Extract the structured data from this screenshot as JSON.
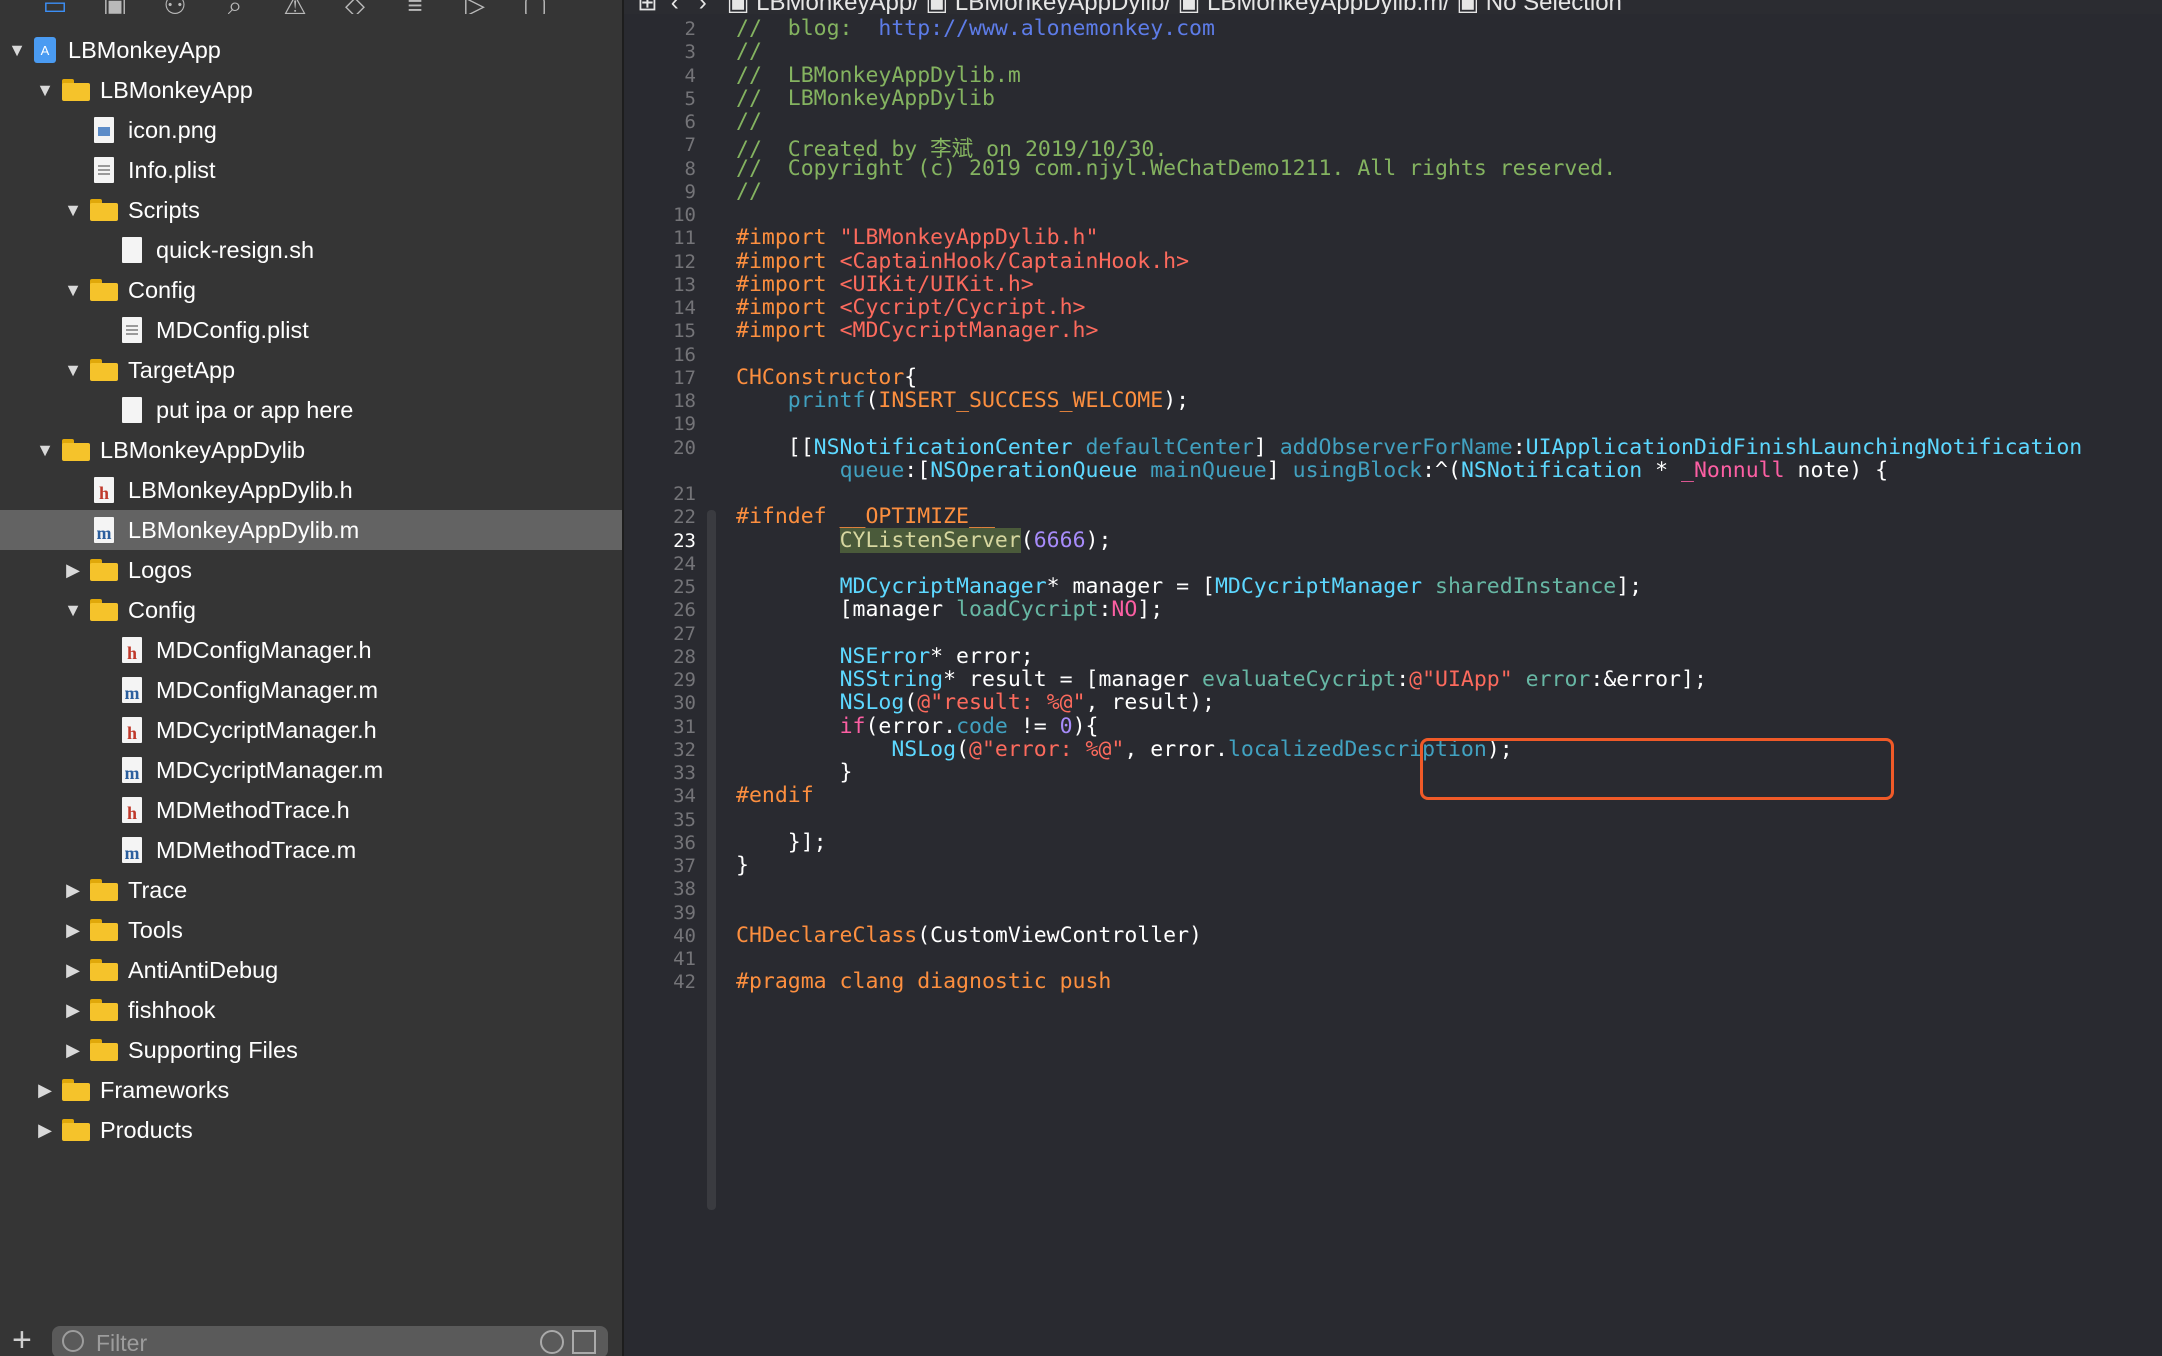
{
  "navigator": {
    "toolbar_icons": [
      "folder-icon",
      "source-control-icon",
      "hierarchy-icon",
      "search-icon",
      "warning-icon",
      "test-icon",
      "debug-icon",
      "breakpoint-icon",
      "report-icon"
    ],
    "items": [
      {
        "label": "LBMonkeyApp",
        "kind": "project",
        "depth": 0,
        "expanded": true
      },
      {
        "label": "LBMonkeyApp",
        "kind": "folder",
        "depth": 1,
        "expanded": true
      },
      {
        "label": "icon.png",
        "kind": "img",
        "depth": 2
      },
      {
        "label": "Info.plist",
        "kind": "plist",
        "depth": 2
      },
      {
        "label": "Scripts",
        "kind": "folder",
        "depth": 2,
        "expanded": true
      },
      {
        "label": "quick-resign.sh",
        "kind": "file",
        "depth": 3
      },
      {
        "label": "Config",
        "kind": "folder",
        "depth": 2,
        "expanded": true
      },
      {
        "label": "MDConfig.plist",
        "kind": "plist",
        "depth": 3
      },
      {
        "label": "TargetApp",
        "kind": "folder",
        "depth": 2,
        "expanded": true
      },
      {
        "label": "put ipa or app here",
        "kind": "file",
        "depth": 3
      },
      {
        "label": "LBMonkeyAppDylib",
        "kind": "folder",
        "depth": 1,
        "expanded": true
      },
      {
        "label": "LBMonkeyAppDylib.h",
        "kind": "h",
        "depth": 2
      },
      {
        "label": "LBMonkeyAppDylib.m",
        "kind": "m",
        "depth": 2,
        "selected": true
      },
      {
        "label": "Logos",
        "kind": "folder",
        "depth": 2,
        "expanded": false
      },
      {
        "label": "Config",
        "kind": "folder",
        "depth": 2,
        "expanded": true
      },
      {
        "label": "MDConfigManager.h",
        "kind": "h",
        "depth": 3
      },
      {
        "label": "MDConfigManager.m",
        "kind": "m",
        "depth": 3
      },
      {
        "label": "MDCycriptManager.h",
        "kind": "h",
        "depth": 3
      },
      {
        "label": "MDCycriptManager.m",
        "kind": "m",
        "depth": 3
      },
      {
        "label": "MDMethodTrace.h",
        "kind": "h",
        "depth": 3
      },
      {
        "label": "MDMethodTrace.m",
        "kind": "m",
        "depth": 3
      },
      {
        "label": "Trace",
        "kind": "folder",
        "depth": 2,
        "expanded": false
      },
      {
        "label": "Tools",
        "kind": "folder",
        "depth": 2,
        "expanded": false
      },
      {
        "label": "AntiAntiDebug",
        "kind": "folder",
        "depth": 2,
        "expanded": false
      },
      {
        "label": "fishhook",
        "kind": "folder",
        "depth": 2,
        "expanded": false
      },
      {
        "label": "Supporting Files",
        "kind": "folder",
        "depth": 2,
        "expanded": false
      },
      {
        "label": "Frameworks",
        "kind": "folder",
        "depth": 1,
        "expanded": false
      },
      {
        "label": "Products",
        "kind": "folder",
        "depth": 1,
        "expanded": false
      }
    ],
    "filter_placeholder": "Filter"
  },
  "jumpbar": {
    "segments": [
      "LBMonkeyApp",
      "LBMonkeyAppDylib",
      "LBMonkeyAppDylib.m",
      "No Selection"
    ]
  },
  "editor": {
    "current_line": 23,
    "lines": [
      {
        "n": "2",
        "tokens": [
          [
            "c-comment",
            "//  blog:  "
          ],
          [
            "c-url",
            "http://www.alonemonkey.com"
          ]
        ]
      },
      {
        "n": "3",
        "tokens": [
          [
            "c-comment",
            "//"
          ]
        ]
      },
      {
        "n": "4",
        "tokens": [
          [
            "c-comment",
            "//  LBMonkeyAppDylib.m"
          ]
        ]
      },
      {
        "n": "5",
        "tokens": [
          [
            "c-comment",
            "//  LBMonkeyAppDylib"
          ]
        ]
      },
      {
        "n": "6",
        "tokens": [
          [
            "c-comment",
            "//"
          ]
        ]
      },
      {
        "n": "7",
        "tokens": [
          [
            "c-comment",
            "//  Created by 李斌 on 2019/10/30."
          ]
        ]
      },
      {
        "n": "8",
        "tokens": [
          [
            "c-comment",
            "//  Copyright (c) 2019 com.njyl.WeChatDemo1211. All rights reserved."
          ]
        ]
      },
      {
        "n": "9",
        "tokens": [
          [
            "c-comment",
            "//"
          ]
        ]
      },
      {
        "n": "10",
        "tokens": []
      },
      {
        "n": "11",
        "tokens": [
          [
            "c-pp",
            "#import "
          ],
          [
            "c-str",
            "\"LBMonkeyAppDylib.h\""
          ]
        ]
      },
      {
        "n": "12",
        "tokens": [
          [
            "c-pp",
            "#import "
          ],
          [
            "c-str",
            "<CaptainHook/CaptainHook.h>"
          ]
        ]
      },
      {
        "n": "13",
        "tokens": [
          [
            "c-pp",
            "#import "
          ],
          [
            "c-str",
            "<UIKit/UIKit.h>"
          ]
        ]
      },
      {
        "n": "14",
        "tokens": [
          [
            "c-pp",
            "#import "
          ],
          [
            "c-str",
            "<Cycript/Cycript.h>"
          ]
        ]
      },
      {
        "n": "15",
        "tokens": [
          [
            "c-pp",
            "#import "
          ],
          [
            "c-str",
            "<MDCycriptManager.h>"
          ]
        ]
      },
      {
        "n": "16",
        "tokens": []
      },
      {
        "n": "17",
        "tokens": [
          [
            "c-macro",
            "CHConstructor"
          ],
          [
            "",
            "{"
          ]
        ]
      },
      {
        "n": "18",
        "tokens": [
          [
            "",
            "    "
          ],
          [
            "c-prop",
            "printf"
          ],
          [
            "",
            "("
          ],
          [
            "c-macro",
            "INSERT_SUCCESS_WELCOME"
          ],
          [
            "",
            ");"
          ]
        ]
      },
      {
        "n": "19",
        "tokens": []
      },
      {
        "n": "20",
        "tokens": [
          [
            "",
            "    [["
          ],
          [
            "c-cls",
            "NSNotificationCenter"
          ],
          [
            "",
            " "
          ],
          [
            "c-prop",
            "defaultCenter"
          ],
          [
            "",
            "] "
          ],
          [
            "c-prop",
            "addObserverForName"
          ],
          [
            "",
            ":"
          ],
          [
            "c-cls",
            "UIApplicationDidFinishLaunchingNotification"
          ]
        ]
      },
      {
        "n": "",
        "tokens": [
          [
            "",
            "        "
          ],
          [
            "c-prop",
            "queue"
          ],
          [
            "",
            ":["
          ],
          [
            "c-cls",
            "NSOperationQueue"
          ],
          [
            "",
            " "
          ],
          [
            "c-prop",
            "mainQueue"
          ],
          [
            "",
            "] "
          ],
          [
            "c-prop",
            "usingBlock"
          ],
          [
            "",
            ":^("
          ],
          [
            "c-cls",
            "NSNotification"
          ],
          [
            "",
            " * "
          ],
          [
            "c-nonnull",
            "_Nonnull"
          ],
          [
            "",
            " note) {"
          ]
        ]
      },
      {
        "n": "21",
        "tokens": []
      },
      {
        "n": "22",
        "tokens": [
          [
            "c-pp",
            "#ifndef __OPTIMIZE__"
          ]
        ]
      },
      {
        "n": "23",
        "tokens": [
          [
            "",
            "        "
          ],
          [
            "hl-sel",
            "CYListenServer"
          ],
          [
            "",
            "("
          ],
          [
            "c-num",
            "6666"
          ],
          [
            "",
            ");"
          ]
        ]
      },
      {
        "n": "24",
        "tokens": []
      },
      {
        "n": "25",
        "tokens": [
          [
            "",
            "        "
          ],
          [
            "c-cls",
            "MDCycriptManager"
          ],
          [
            "",
            "* manager = ["
          ],
          [
            "c-cls",
            "MDCycriptManager"
          ],
          [
            "",
            " "
          ],
          [
            "c-ident",
            "sharedInstance"
          ],
          [
            "",
            "];"
          ]
        ]
      },
      {
        "n": "26",
        "tokens": [
          [
            "",
            "        [manager "
          ],
          [
            "c-ident",
            "loadCycript"
          ],
          [
            "",
            ":"
          ],
          [
            "c-kw",
            "NO"
          ],
          [
            "",
            "];"
          ]
        ]
      },
      {
        "n": "27",
        "tokens": []
      },
      {
        "n": "28",
        "tokens": [
          [
            "",
            "        "
          ],
          [
            "c-cls",
            "NSError"
          ],
          [
            "",
            "* error;"
          ]
        ]
      },
      {
        "n": "29",
        "tokens": [
          [
            "",
            "        "
          ],
          [
            "c-cls",
            "NSString"
          ],
          [
            "",
            "* result = [manager "
          ],
          [
            "c-ident",
            "evaluateCycript"
          ],
          [
            "",
            ":"
          ],
          [
            "c-str",
            "@\"UIApp\""
          ],
          [
            "",
            " "
          ],
          [
            "c-ident",
            "error"
          ],
          [
            "",
            ":&error];"
          ]
        ]
      },
      {
        "n": "30",
        "tokens": [
          [
            "",
            "        "
          ],
          [
            "c-cls",
            "NSLog"
          ],
          [
            "",
            "("
          ],
          [
            "c-str",
            "@\"result: %@\""
          ],
          [
            "",
            ", result);"
          ]
        ]
      },
      {
        "n": "31",
        "tokens": [
          [
            "",
            "        "
          ],
          [
            "c-kw",
            "if"
          ],
          [
            "",
            "(error."
          ],
          [
            "c-prop",
            "code"
          ],
          [
            "",
            " != "
          ],
          [
            "c-num",
            "0"
          ],
          [
            "",
            "){"
          ]
        ]
      },
      {
        "n": "32",
        "tokens": [
          [
            "",
            "            "
          ],
          [
            "c-cls",
            "NSLog"
          ],
          [
            "",
            "("
          ],
          [
            "c-str",
            "@\"error: %@\""
          ],
          [
            "",
            ", error."
          ],
          [
            "c-prop",
            "localizedDescription"
          ],
          [
            "",
            ");"
          ]
        ]
      },
      {
        "n": "33",
        "tokens": [
          [
            "",
            "        }"
          ]
        ]
      },
      {
        "n": "34",
        "tokens": [
          [
            "c-pp",
            "#endif"
          ]
        ]
      },
      {
        "n": "35",
        "tokens": []
      },
      {
        "n": "36",
        "tokens": [
          [
            "",
            "    }];"
          ]
        ]
      },
      {
        "n": "37",
        "tokens": [
          [
            "",
            "}"
          ]
        ]
      },
      {
        "n": "38",
        "tokens": []
      },
      {
        "n": "39",
        "tokens": []
      },
      {
        "n": "40",
        "tokens": [
          [
            "c-macro",
            "CHDeclareClass"
          ],
          [
            "",
            "(CustomViewController)"
          ]
        ]
      },
      {
        "n": "41",
        "tokens": []
      },
      {
        "n": "42",
        "tokens": [
          [
            "c-pp",
            "#pragma clang diagnostic push"
          ]
        ]
      }
    ]
  },
  "colors": {
    "navigator_bg": "#353535",
    "selection_bg": "#636363",
    "editor_bg": "#292a30",
    "folder": "#f5c32b",
    "highlight_box": "#f05a28"
  }
}
